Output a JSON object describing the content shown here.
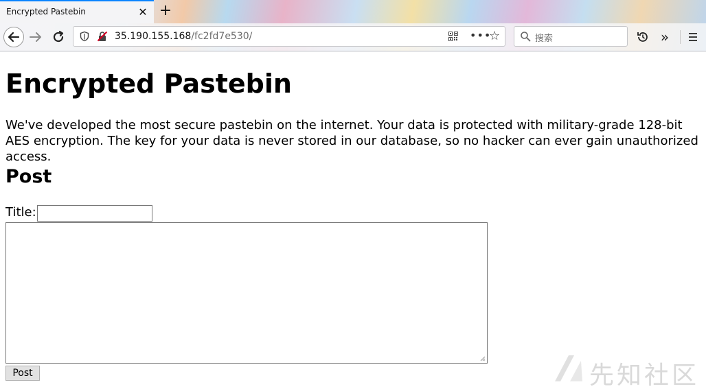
{
  "browser": {
    "tab_title": "Encrypted Pastebin",
    "url_host": "35.190.155.168",
    "url_path": "/fc2fd7e530/",
    "search_placeholder": "搜索"
  },
  "page": {
    "heading": "Encrypted Pastebin",
    "intro": "We've developed the most secure pastebin on the internet. Your data is protected with military-grade 128-bit AES encryption. The key for your data is never stored in our database, so no hacker can ever gain unauthorized access.",
    "post_heading": "Post",
    "title_label": "Title:",
    "title_value": "",
    "content_value": "",
    "post_button": "Post"
  },
  "watermark": {
    "text": "先知社区"
  },
  "icons": {
    "back": "back-arrow-icon",
    "forward": "forward-arrow-icon",
    "reload": "reload-icon",
    "shield": "shield-icon",
    "insecure": "insecure-lock-icon",
    "qr": "qr-code-icon",
    "more": "more-icon",
    "star": "star-icon",
    "search": "search-icon",
    "history": "history-icon",
    "overflow": "overflow-chevron-icon",
    "menu": "hamburger-menu-icon"
  },
  "colors": {
    "tab_accent": "#0a84ff",
    "insecure_red": "#d70022"
  }
}
